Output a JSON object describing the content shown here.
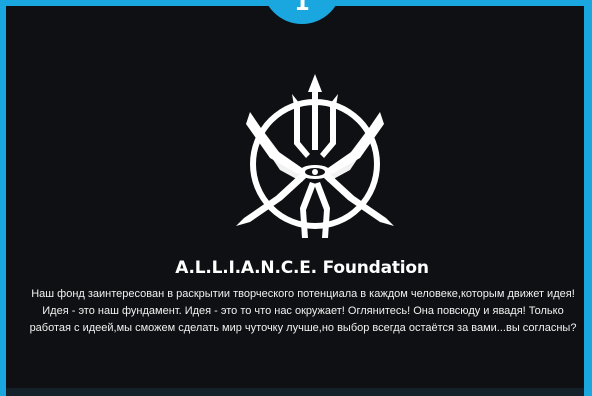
{
  "badge": {
    "number": "1"
  },
  "foundation": {
    "title": "A.L.L.I.A.N.C.E. Foundation",
    "description_lines": [
      "Наш фонд заинтересован в раскрытии творческого потенциала в каждом человеке,которым движет идея!",
      "Идея - это наш фундамент. Идея - это то что нас окружает! Оглянитесь! Она повсюду и явадя! Только",
      "работая с идеей,мы сможем сделать мир чуточку лучше,но выбор всегда остаётся за вами...вы согласны?"
    ]
  },
  "colors": {
    "accent": "#1aa6df",
    "background": "#0f1013",
    "text": "#ffffff"
  },
  "icons": {
    "emblem": "alliance-trident-emblem"
  }
}
